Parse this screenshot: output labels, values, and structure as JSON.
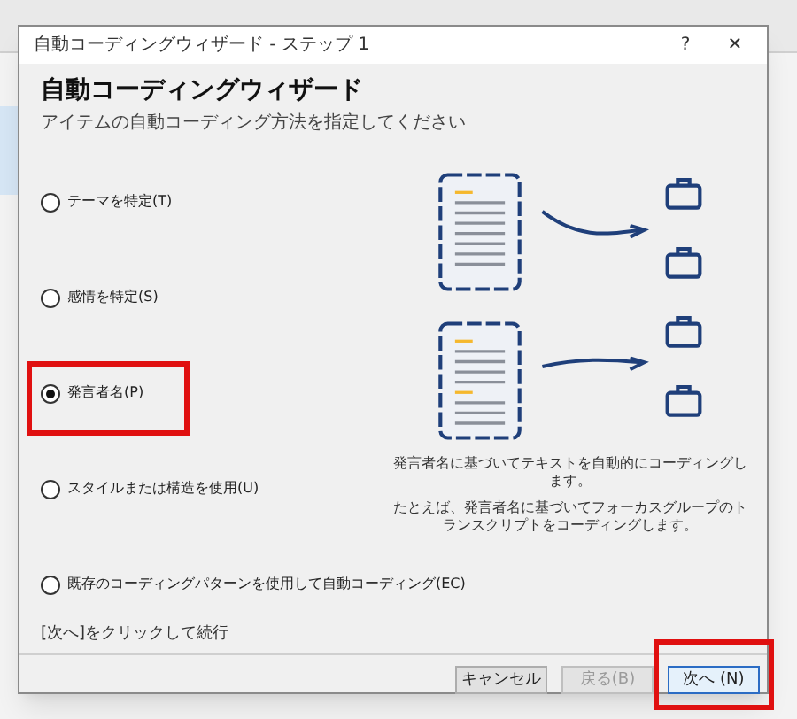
{
  "window": {
    "title": "自動コーディングウィザード - ステップ 1",
    "help": "?",
    "close": "✕"
  },
  "header": {
    "title": "自動コーディングウィザード",
    "subtitle": "アイテムの自動コーディング方法を指定してください"
  },
  "options": [
    {
      "label": "テーマを特定(T)",
      "selected": false,
      "highlighted": false
    },
    {
      "label": "感情を特定(S)",
      "selected": false,
      "highlighted": false
    },
    {
      "label": "発言者名(P)",
      "selected": true,
      "highlighted": true
    },
    {
      "label": "スタイルまたは構造を使用(U)",
      "selected": false,
      "highlighted": false
    },
    {
      "label": "既存のコーディングパターンを使用して自動コーディング(EC)",
      "selected": false,
      "highlighted": false
    }
  ],
  "description": [
    "発言者名に基づいてテキストを自動的にコーディングします。",
    "たとえば、発言者名に基づいてフォーカスグループのトランスクリプトをコーディングします。"
  ],
  "hint": "[次へ]をクリックして続行",
  "buttons": [
    {
      "label": "キャンセル",
      "disabled": false,
      "highlighted": false
    },
    {
      "label": "戻る(B)",
      "disabled": true,
      "highlighted": false
    },
    {
      "label": "次へ (N)",
      "disabled": false,
      "highlighted": true
    }
  ]
}
